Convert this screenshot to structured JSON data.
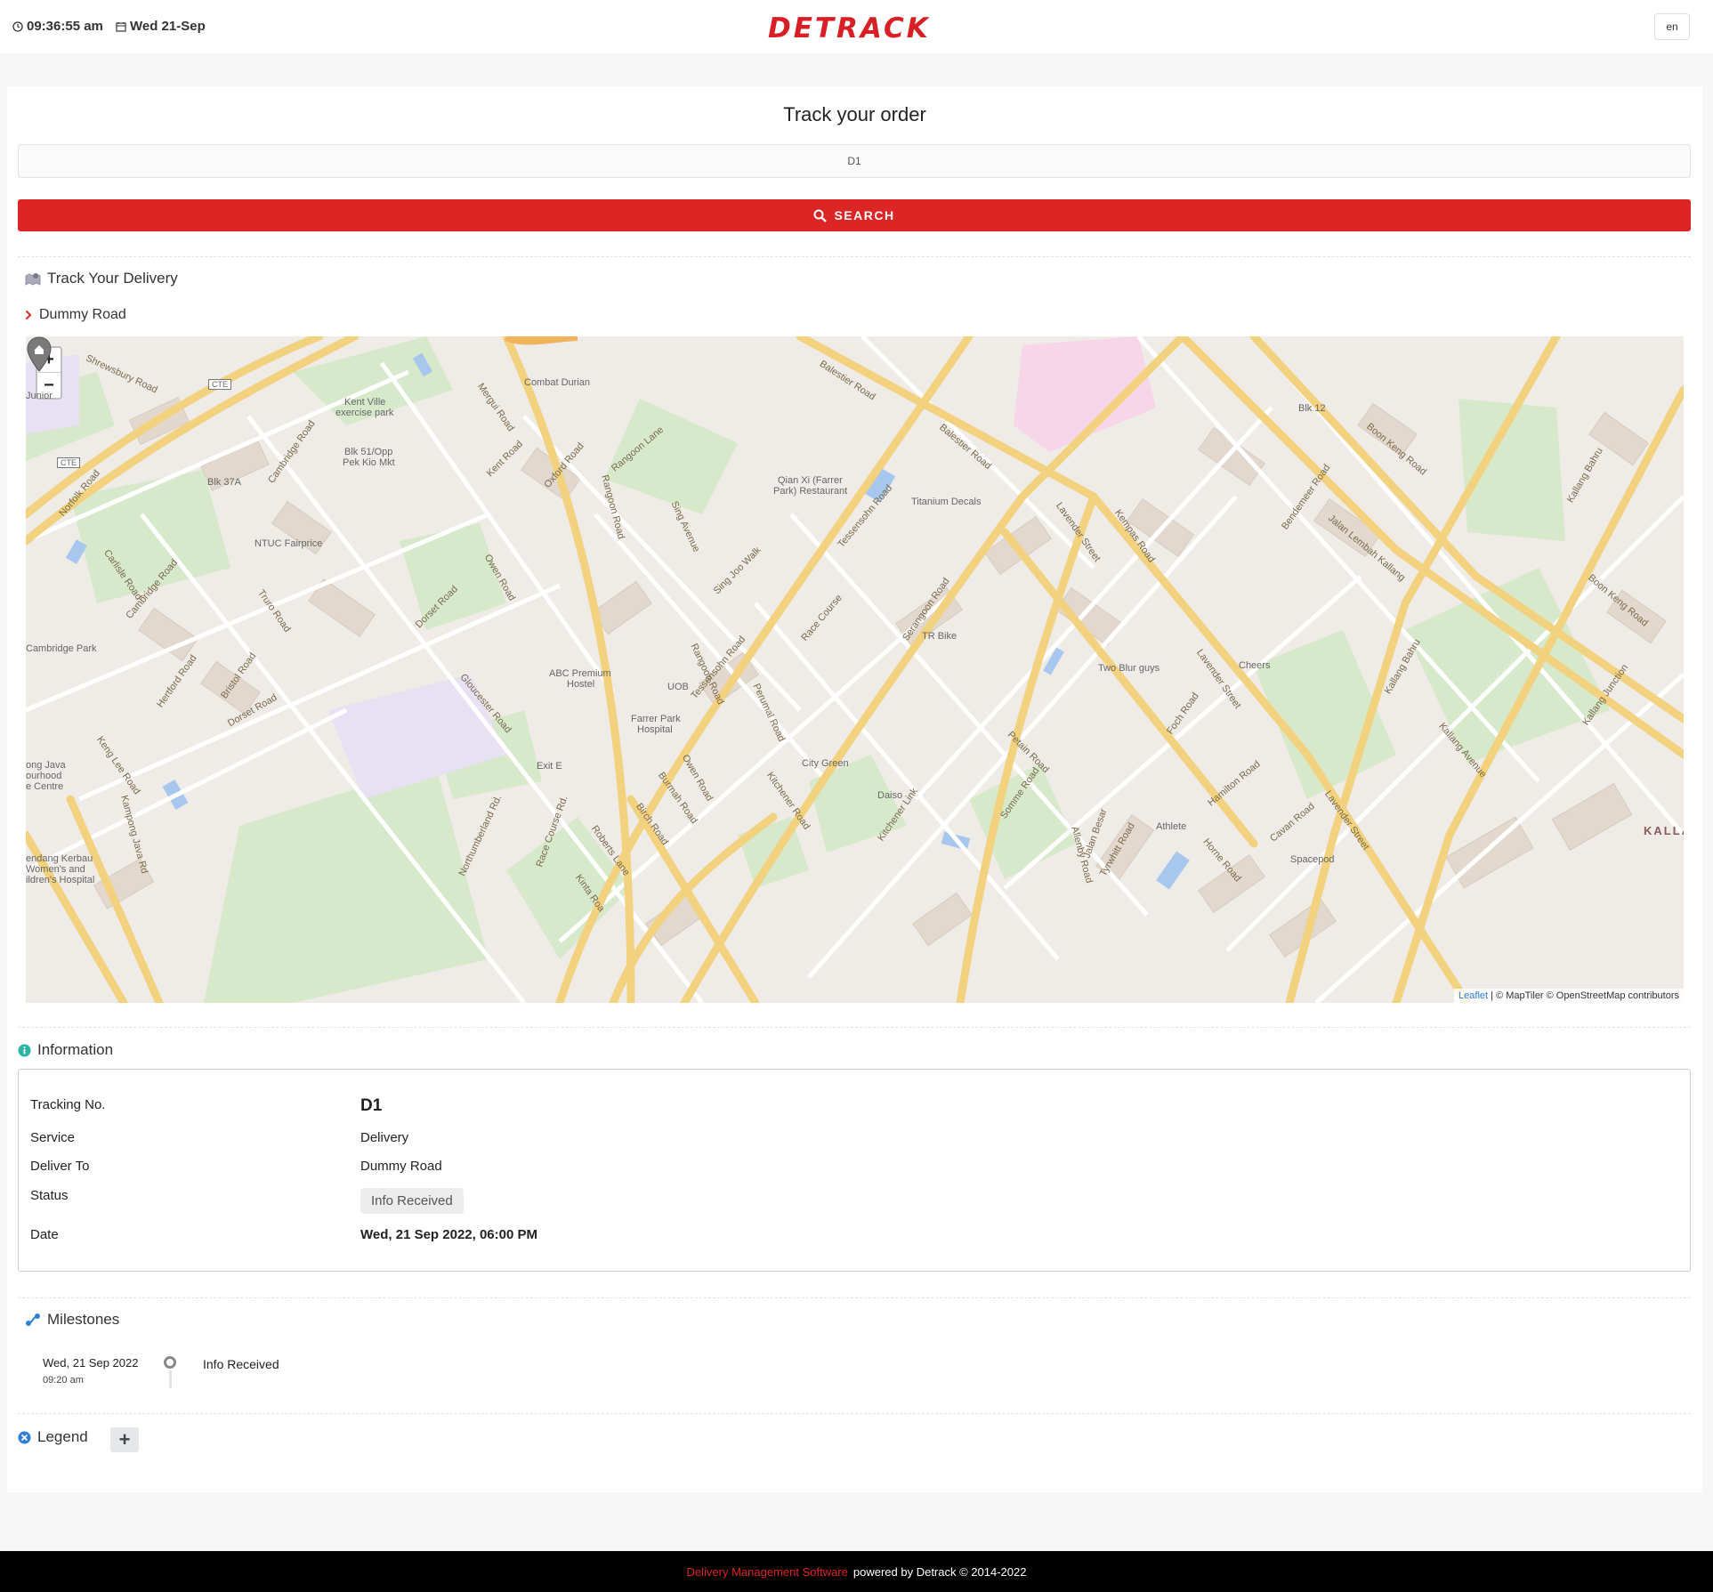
{
  "header": {
    "time": "09:36:55 am",
    "date": "Wed 21-Sep",
    "logo": "DETRACK",
    "language": "en"
  },
  "search": {
    "title": "Track your order",
    "value": "D1",
    "button_label": "SEARCH"
  },
  "tracking": {
    "heading": "Track Your Delivery",
    "address": "Dummy Road"
  },
  "map": {
    "zoom_in": "+",
    "zoom_out": "−",
    "attribution_leaflet": "Leaflet",
    "attribution_rest": "| © MapTiler © OpenStreetMap contributors",
    "labels": {
      "combat_durian": "Combat Durian",
      "kent_ville": "Kent Ville",
      "exercise_park": "exercise park",
      "blk51": "Blk 51/Opp",
      "pek_kio": "Pek Kio Mkt",
      "blk37a": "Blk 37A",
      "ntuc": "NTUC Fairprice",
      "qian_xi": "Qian Xi (Farrer",
      "park_restaurant": "Park) Restaurant",
      "titanium": "Titanium Decals",
      "blk12": "Blk 12",
      "cambridge_park": "Cambridge Park",
      "abc1": "ABC Premium",
      "abc2": "Hostel",
      "uob": "UOB",
      "farrer1": "Farrer Park",
      "farrer2": "Hospital",
      "tr_bike": "TR Bike",
      "two_blur": "Two Blur guys",
      "cheers": "Cheers",
      "city_green": "City Green",
      "daiso": "Daiso",
      "athlete": "Athlete",
      "spacepod": "Spacepod",
      "kalla": "KALLA",
      "exit_e": "Exit E",
      "junior": "Junior",
      "long_java1": "ong Java",
      "long_java2": "ourhood",
      "long_java3": "e Centre",
      "kerbau1": "endang Kerbau",
      "kerbau2": "Women's and",
      "kerbau3": "ildren's Hospital",
      "r_balestier": "Balestier Road",
      "r_balestier2": "Balestier Road",
      "r_lavender": "Lavender Street",
      "r_lavender2": "Lavender Street",
      "r_lavender3": "Lavender Street",
      "r_kempas": "Kempas Road",
      "r_bendemeer": "Bendemeer Road",
      "r_boon_keng": "Boon Keng Road",
      "r_boon_keng2": "Boon Keng Road",
      "r_jalan_lembah": "Jalan Lembah Kallang",
      "r_kallang_bahru": "Kallang Bahru",
      "r_kallang_bahru2": "Kallang Bahru",
      "r_tessensohn": "Tessensohn Road",
      "r_tessensohn2": "Tessensohn Road",
      "r_rangoon": "Rangoon Road",
      "r_rangoon2": "Rangoon Road",
      "r_rangoon_lane": "Rangoon Lane",
      "r_sing_avenue": "Sing Avenue",
      "r_sing_joo": "Sing Joo Walk",
      "r_race_course": "Race Course",
      "r_serangoon": "Serangoon Road",
      "r_owen": "Owen Road",
      "r_owen2": "Owen Road",
      "r_dorset": "Dorset Road",
      "r_dorset2": "Dorset Road",
      "r_gloucester": "Gloucester Road",
      "r_perumal": "Perumal Road",
      "r_kitchener": "Kitchener Road",
      "r_kitchener_link": "Kitchener Link",
      "r_petain": "Petain Road",
      "r_somme": "Somme Road",
      "r_jalan_besar": "Jalan Besar",
      "r_foch": "Foch Road",
      "r_hamilton": "Hamilton Road",
      "r_cavan": "Cavan Road",
      "r_horne": "Horne Road",
      "r_tyrwhitt": "Tyrwhitt Road",
      "r_allenby": "Allenby Road",
      "r_kallang_ave": "Kallang Avenue",
      "r_kallang_junc": "Kallang Junction",
      "r_shrewsbury": "Shrewsbury Road",
      "r_mergui": "Mergui Road",
      "r_kent": "Kent Road",
      "r_oxford": "Oxford Road",
      "r_cambridge": "Cambridge Road",
      "r_cambridge2": "Cambridge Road",
      "r_norfolk": "Norfolk Road",
      "r_carlisle": "Carlisle Road",
      "r_truro": "Truro Road",
      "r_hertford": "Hertford Road",
      "r_bristol": "Bristol Road",
      "r_keng_lee": "Keng Lee Road",
      "r_kampong_java": "Kampong Java Rd",
      "r_northumberland": "Northumberland Rd.",
      "r_race_course_rd": "Race Course Rd.",
      "r_roberts": "Roberts Lane",
      "r_birch": "Birch Road",
      "r_burmah": "Burmah Road",
      "r_kinta": "Kinta Roa",
      "r_cte": "CTE",
      "r_cte2": "CTE"
    }
  },
  "information": {
    "heading": "Information",
    "tracking_label": "Tracking No.",
    "tracking_value": "D1",
    "service_label": "Service",
    "service_value": "Delivery",
    "deliver_label": "Deliver To",
    "deliver_value": "Dummy Road",
    "status_label": "Status",
    "status_value": "Info Received",
    "date_label": "Date",
    "date_value": "Wed, 21 Sep 2022, 06:00 PM"
  },
  "milestones": {
    "heading": "Milestones",
    "items": [
      {
        "date": "Wed, 21 Sep 2022",
        "time": "09:20 am",
        "status": "Info Received"
      }
    ]
  },
  "legend": {
    "heading": "Legend",
    "toggle": "+"
  },
  "footer": {
    "link": "Delivery Management Software",
    "text": "powered by Detrack © 2014-2022"
  },
  "colors": {
    "accent": "#dc2626",
    "road_major": "#f5d780",
    "park": "#d5e8c8",
    "building": "#e3d9ce",
    "info_icon": "#2bb3a4",
    "milestone_icon": "#2f80d6"
  }
}
